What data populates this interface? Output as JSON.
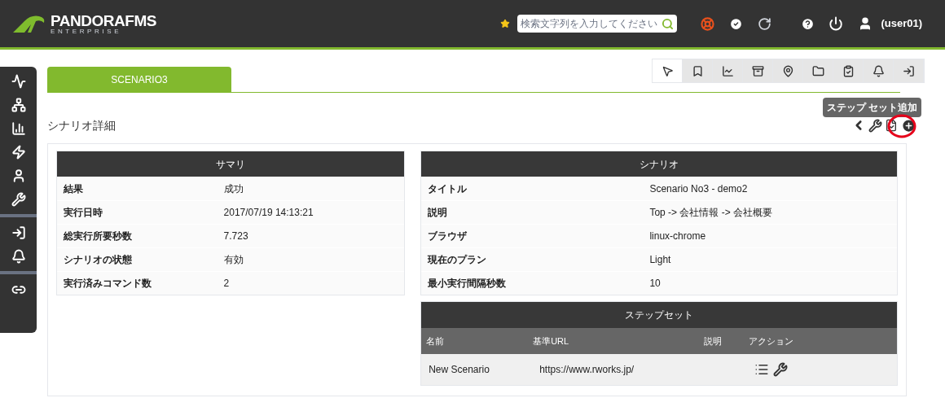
{
  "header": {
    "logo": {
      "name": "PANDORAFMS",
      "edition": "ENTERPRISE"
    },
    "search": {
      "placeholder": "検索文字列を入力してください"
    },
    "user": "(user01)"
  },
  "tabs": [
    {
      "label": "SCENARIO3",
      "selected": true
    }
  ],
  "toolbar": [
    {
      "kind": "browser",
      "selected": true
    },
    {
      "kind": "book",
      "selected": false
    },
    {
      "kind": "chart",
      "selected": false
    },
    {
      "kind": "archive",
      "selected": false
    },
    {
      "kind": "pin",
      "selected": false
    },
    {
      "kind": "folder",
      "selected": false
    },
    {
      "kind": "checklist",
      "selected": false
    },
    {
      "kind": "bell",
      "selected": false
    },
    {
      "kind": "exit",
      "selected": false
    }
  ],
  "tooltip": "ステップ セット追加",
  "page_title": "シナリオ詳細",
  "summary": {
    "title": "サマリ",
    "rows": [
      {
        "label": "結果",
        "value": "成功"
      },
      {
        "label": "実行日時",
        "value": "2017/07/19 14:13:21"
      },
      {
        "label": "総実行所要秒数",
        "value": "7.723"
      },
      {
        "label": "シナリオの状態",
        "value": "有効"
      },
      {
        "label": "実行済みコマンド数",
        "value": "2"
      }
    ]
  },
  "scenario": {
    "title": "シナリオ",
    "rows": [
      {
        "label": "タイトル",
        "value": "Scenario No3 - demo2"
      },
      {
        "label": "説明",
        "value": "Top -> 会社情報 -> 会社概要"
      },
      {
        "label": "ブラウザ",
        "value": "linux-chrome"
      },
      {
        "label": "現在のプラン",
        "value": "Light"
      },
      {
        "label": "最小実行間隔秒数",
        "value": "10"
      }
    ]
  },
  "step_sets": {
    "title": "ステップセット",
    "columns": [
      "名前",
      "基準URL",
      "説明",
      "アクション"
    ],
    "rows": [
      {
        "name": "New Scenario",
        "url": "https://www.rworks.jp/",
        "description": ""
      }
    ]
  }
}
